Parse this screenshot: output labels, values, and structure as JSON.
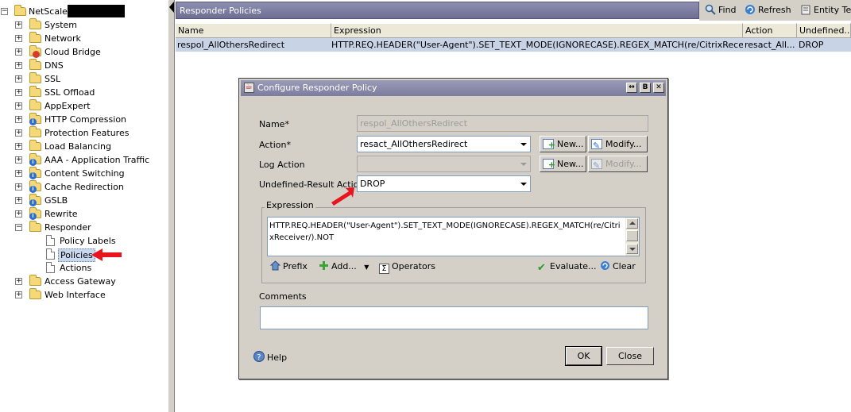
{
  "tree": {
    "root": "NetScaler",
    "items": [
      {
        "label": "System",
        "icon": "folder-icon"
      },
      {
        "label": "Network",
        "icon": "folder-icon"
      },
      {
        "label": "Cloud Bridge",
        "icon": "folder-icon"
      },
      {
        "label": "DNS",
        "icon": "folder-icon"
      },
      {
        "label": "SSL",
        "icon": "folder-icon"
      },
      {
        "label": "SSL Offload",
        "icon": "folder-icon"
      },
      {
        "label": "AppExpert",
        "icon": "folder-icon"
      },
      {
        "label": "HTTP Compression",
        "icon": "folder-info-icon"
      },
      {
        "label": "Protection Features",
        "icon": "folder-icon"
      },
      {
        "label": "Load Balancing",
        "icon": "folder-icon"
      },
      {
        "label": "AAA - Application Traffic",
        "icon": "folder-info-icon"
      },
      {
        "label": "Content Switching",
        "icon": "folder-info-icon"
      },
      {
        "label": "Cache Redirection",
        "icon": "folder-info-icon"
      },
      {
        "label": "GSLB",
        "icon": "folder-info-icon"
      },
      {
        "label": "Rewrite",
        "icon": "folder-info-icon"
      },
      {
        "label": "Responder",
        "icon": "folder-icon"
      },
      {
        "label": "Policy Labels",
        "icon": "page-icon"
      },
      {
        "label": "Policies",
        "icon": "page-icon"
      },
      {
        "label": "Actions",
        "icon": "page-icon"
      },
      {
        "label": "Access Gateway",
        "icon": "folder-icon"
      },
      {
        "label": "Web Interface",
        "icon": "folder-icon"
      }
    ]
  },
  "panel": {
    "title": "Responder Policies",
    "toolbar": {
      "find": "Find",
      "refresh": "Refresh",
      "entity": "Entity Ter"
    },
    "columns": [
      "Name",
      "Expression",
      "Action",
      "Undefined..."
    ],
    "rows": [
      {
        "name": "respol_AllOthersRedirect",
        "expression": "HTTP.REQ.HEADER(\"User-Agent\").SET_TEXT_MODE(IGNORECASE).REGEX_MATCH(re/CitrixReceiver/)....",
        "action": "resact_All...",
        "undefined": "DROP"
      }
    ]
  },
  "dialog": {
    "title": "Configure Responder Policy",
    "name_label": "Name*",
    "name_value": "respol_AllOthersRedirect",
    "action_label": "Action*",
    "action_value": "resact_AllOthersRedirect",
    "log_action_label": "Log Action",
    "log_action_value": "",
    "undef_label": "Undefined-Result Action",
    "undef_value": "DROP",
    "new_label": "New...",
    "modify_label": "Modify...",
    "expression_label": "Expression",
    "expression_value": "HTTP.REQ.HEADER(\"User-Agent\").SET_TEXT_MODE(IGNORECASE).REGEX_MATCH(re/CitrixReceiver/).NOT",
    "tools": {
      "prefix": "Prefix",
      "add": "Add...",
      "operators": "Operators",
      "evaluate": "Evaluate...",
      "clear": "Clear"
    },
    "comments_label": "Comments",
    "comments_value": "",
    "help": "Help",
    "ok": "OK",
    "close": "Close"
  },
  "colors": {
    "annotation_arrow": "#e8141e",
    "title_bar": "#7c7d9e",
    "selected_row": "#c9d3e6"
  }
}
